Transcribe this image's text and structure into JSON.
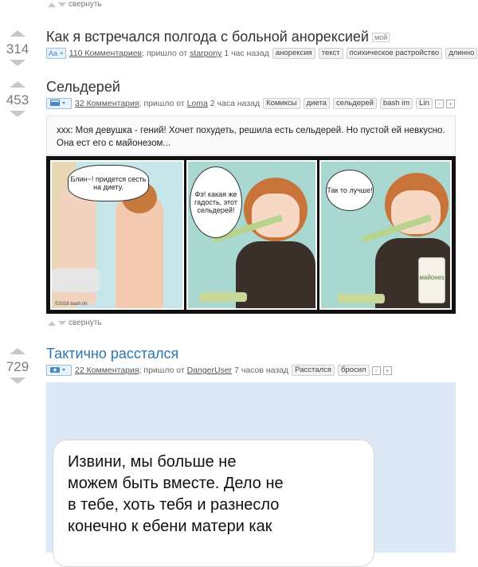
{
  "top": {
    "collapse_label": "свернуть"
  },
  "posts": [
    {
      "score": "314",
      "title": "Как я встречался полгода с больной анорексией",
      "my_label": "мой",
      "badge": "Aa +",
      "comments": "110 Комментариев",
      "came_from": "; пришло от",
      "author": "starpony",
      "time": "1 час назад",
      "tags": [
        "анорексия",
        "текст",
        "психическое растройство",
        "длинно"
      ]
    },
    {
      "score": "453",
      "title": "Сельдерей",
      "comments": "32 Комментария",
      "came_from": "; пришло от",
      "author": "Loma",
      "time": "2 часа назад",
      "tags": [
        "Комиксы",
        "диета",
        "сельдерей",
        "bash im",
        "Lin"
      ],
      "quote": "xxx: Моя девушка - гений! Хочет похудеть, решила есть сельдерей. Но пустой ей невкусно. Она ест его с майонезом...",
      "comic": {
        "bubble1": "Блин~! придется сесть на диету.",
        "bubble2": "Фэ! какая же гадость, этот сельдерей!",
        "bubble3": "Так то лучше!",
        "copyright": "©2016 bash.im",
        "mayo_label": "майонез"
      },
      "collapse_label": "свернуть"
    },
    {
      "score": "729",
      "title": "Тактично расстался",
      "comments": "22 Комментария",
      "came_from": "; пришло от",
      "author": "DangerUser",
      "time": "7 часов назад",
      "tags": [
        "Расстался",
        "бросил"
      ],
      "message_lines": [
        "Извини, мы больше не",
        "можем быть вместе. Дело не",
        "в тебе, хоть тебя и разнесло",
        "конечно к ебени матери как"
      ]
    }
  ],
  "colors": {
    "link_blue": "#2a75b3",
    "comic_bg": "#a9d8d0",
    "message_bg": "#dde9f6"
  }
}
